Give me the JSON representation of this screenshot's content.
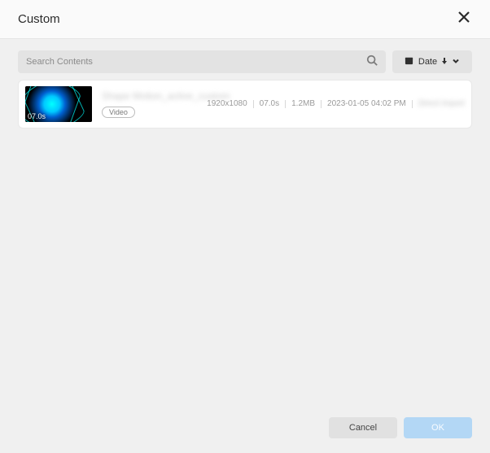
{
  "header": {
    "title": "Custom"
  },
  "toolbar": {
    "search_placeholder": "Search Contents",
    "sort_label": "Date"
  },
  "item": {
    "title": "Shape Motion_active_custom",
    "thumb_duration": "07.0s",
    "type_badge": "Video",
    "resolution": "1920x1080",
    "duration": "07.0s",
    "size": "1.2MB",
    "datetime": "2023-01-05 04:02 PM",
    "extra": "Direct Import"
  },
  "footer": {
    "cancel_label": "Cancel",
    "ok_label": "OK"
  }
}
